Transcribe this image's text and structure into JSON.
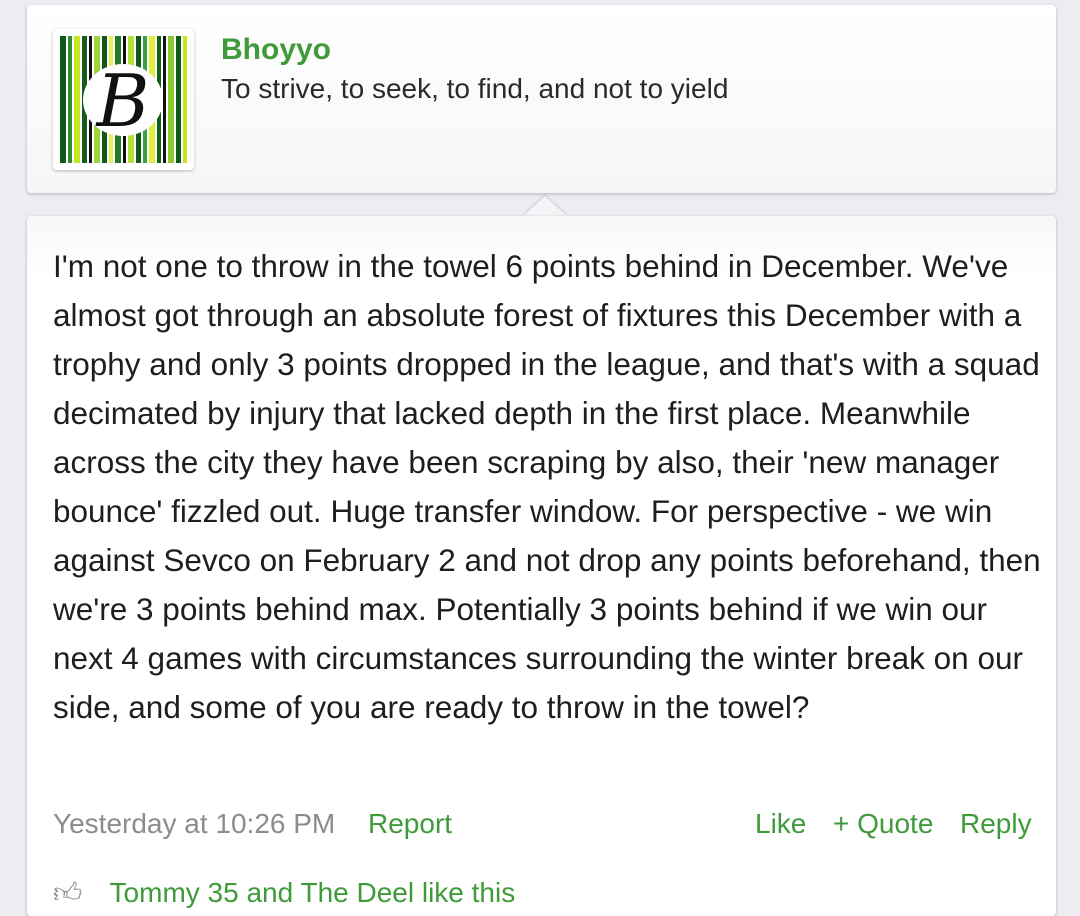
{
  "user": {
    "name": "Bhoyyo",
    "title": "To strive, to seek, to find, and not to yield",
    "avatar_letter": "B"
  },
  "post": {
    "message": "I'm not one to throw in the towel 6 points behind in December. We've almost got through an absolute forest of fixtures this December with a trophy and only 3 points dropped in the league, and that's with a squad decimated by injury that lacked depth in the first place. Meanwhile across the city they have been scraping by also, their 'new manager bounce' fizzled out. Huge transfer window. For perspective - we win against Sevco on February 2 and not drop any points beforehand, then we're 3 points behind max. Potentially 3 points behind if we win our next 4 games with circumstances surrounding the winter break on our side, and some of you are ready to throw in the towel?",
    "date": "Yesterday at 10:26 PM",
    "actions": {
      "report": "Report",
      "like": "Like",
      "quote": "+ Quote",
      "reply": "Reply"
    },
    "likes_text": "Tommy 35 and The Deel like this"
  },
  "colors": {
    "accent": "#3f9a3a",
    "muted": "#8c8c8c",
    "text": "#1e1e1e"
  }
}
